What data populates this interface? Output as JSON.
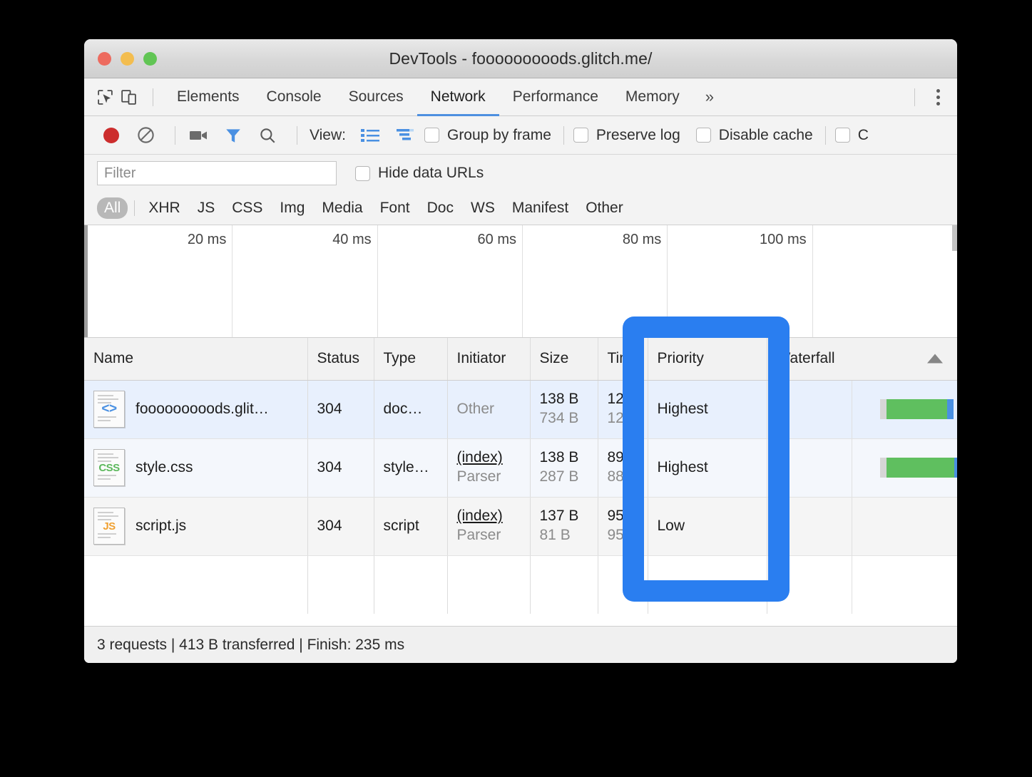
{
  "window": {
    "title": "DevTools - fooooooooods.glitch.me/",
    "traffic": {
      "close": "close-button",
      "minimize": "minimize-button",
      "zoom": "zoom-button"
    }
  },
  "tabstrip": {
    "inspect_icon": "inspect-element-icon",
    "device_icon": "device-toolbar-icon",
    "tabs": [
      {
        "label": "Elements",
        "active": false
      },
      {
        "label": "Console",
        "active": false
      },
      {
        "label": "Sources",
        "active": false
      },
      {
        "label": "Network",
        "active": true
      },
      {
        "label": "Performance",
        "active": false
      },
      {
        "label": "Memory",
        "active": false
      }
    ],
    "overflow": "»",
    "menu": "more-options"
  },
  "toolbar": {
    "record_icon": "record-button",
    "clear_icon": "clear-button",
    "camera_icon": "screenshot-capture-icon",
    "filter_icon": "filter-icon",
    "search_icon": "search-icon",
    "view_label": "View:",
    "list_view_icon": "list-view-icon",
    "waterfall_view_icon": "waterfall-view-icon",
    "checkboxes": [
      {
        "label": "Group by frame",
        "checked": false
      },
      {
        "label": "Preserve log",
        "checked": false
      },
      {
        "label": "Disable cache",
        "checked": false
      }
    ],
    "truncated_checkbox_label": "C"
  },
  "filter": {
    "placeholder": "Filter",
    "value": "",
    "hide_data_urls_label": "Hide data URLs",
    "hide_data_urls_checked": false
  },
  "type_chips": {
    "selected": "All",
    "items": [
      "All",
      "XHR",
      "JS",
      "CSS",
      "Img",
      "Media",
      "Font",
      "Doc",
      "WS",
      "Manifest",
      "Other"
    ]
  },
  "overview": {
    "ticks": [
      "20 ms",
      "40 ms",
      "60 ms",
      "80 ms",
      "100 ms"
    ]
  },
  "table": {
    "columns": [
      "Name",
      "Status",
      "Type",
      "Initiator",
      "Size",
      "Time",
      "Priority",
      "Waterfall"
    ],
    "sort_column": "Waterfall",
    "sort_direction": "ascending",
    "rows": [
      {
        "icon": "document-file-icon",
        "icon_badge": "<>",
        "name": "fooooooooods.glit…",
        "status": "304",
        "type": "doc…",
        "initiator": "Other",
        "initiator_sub": "",
        "initiator_is_link": false,
        "size": "138 B",
        "size_sub": "734 B",
        "time": "12…",
        "time_sub": "12…",
        "priority": "Highest"
      },
      {
        "icon": "css-file-icon",
        "icon_badge": "CSS",
        "name": "style.css",
        "status": "304",
        "type": "style…",
        "initiator": "(index)",
        "initiator_sub": "Parser",
        "initiator_is_link": true,
        "size": "138 B",
        "size_sub": "287 B",
        "time": "89…",
        "time_sub": "88…",
        "priority": "Highest"
      },
      {
        "icon": "js-file-icon",
        "icon_badge": "JS",
        "name": "script.js",
        "status": "304",
        "type": "script",
        "initiator": "(index)",
        "initiator_sub": "Parser",
        "initiator_is_link": true,
        "size": "137 B",
        "size_sub": "81 B",
        "time": "95…",
        "time_sub": "95…",
        "priority": "Low"
      }
    ]
  },
  "statusbar": {
    "text": "3 requests | 413 B transferred | Finish: 235 ms"
  },
  "annotation": {
    "name": "priority-column-highlight",
    "color": "#2a7ef0"
  },
  "colors": {
    "accent_blue": "#4d8fe0",
    "highlight_blue": "#2a7ef0",
    "record_red": "#cc2d2d",
    "waterfall_green": "#5fbf5f",
    "selected_row": "#e8f0fd"
  }
}
